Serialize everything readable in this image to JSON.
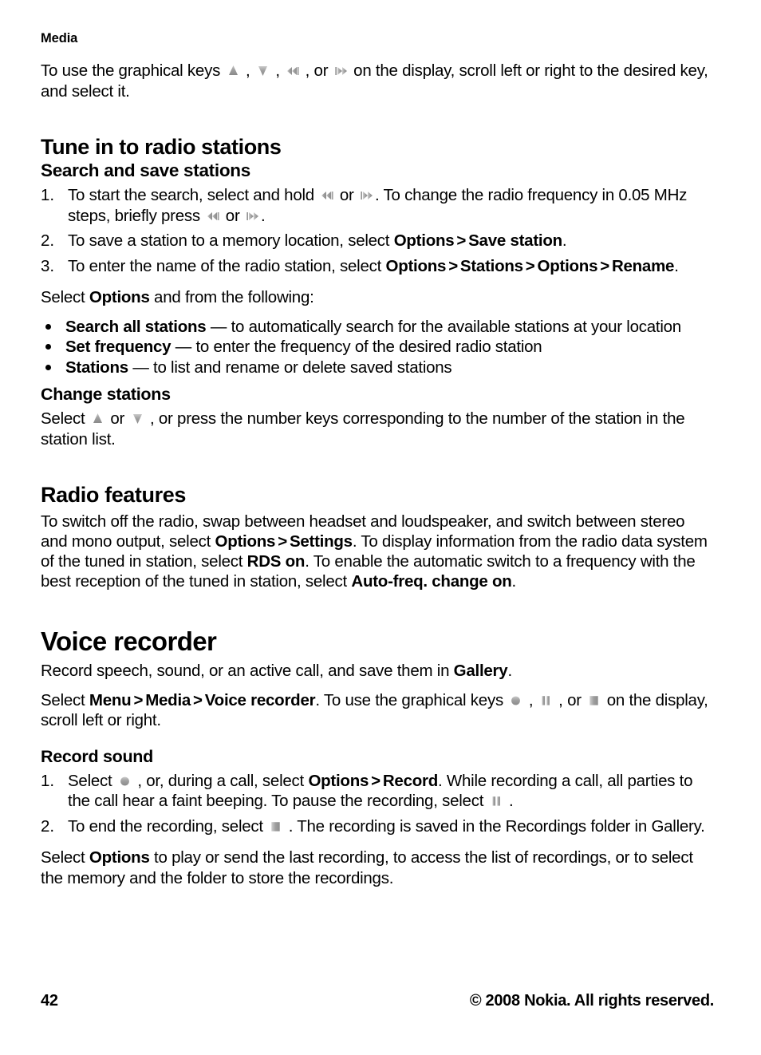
{
  "document": {
    "running_header": "Media",
    "page_number": "42",
    "copyright": "© 2008 Nokia. All rights reserved."
  },
  "intro": {
    "t1": "To use the graphical keys ",
    "t2": " , ",
    "t3": " , ",
    "t4": " , or ",
    "t5": " on the display, scroll left or right to the desired key, and select it."
  },
  "tune_in": {
    "heading": "Tune in to radio stations",
    "subheading": "Search and save stations",
    "steps": [
      {
        "num": "1.",
        "t1": "To start the search, select and hold ",
        "t2": " or ",
        "t3": ". To change the radio frequency in 0.05 MHz steps, briefly press ",
        "t4": " or ",
        "t5": "."
      },
      {
        "num": "2.",
        "t1": "To save a station to a memory location, select ",
        "b1": "Options",
        "gt": ">",
        "b2": "Save station",
        "t2": "."
      },
      {
        "num": "3.",
        "t1": "To enter the name of the radio station, select ",
        "b1": "Options",
        "gt1": ">",
        "b2": "Stations",
        "gt2": ">",
        "b3": "Options",
        "gt3": ">",
        "b4": "Rename",
        "t2": "."
      }
    ],
    "options_lead_1": "Select ",
    "options_lead_bold": "Options",
    "options_lead_2": " and from the following:",
    "bullets": [
      {
        "term": "Search all stations",
        "desc": " — to automatically search for the available stations at your location"
      },
      {
        "term": "Set frequency",
        "desc": " — to enter the frequency of the desired radio station"
      },
      {
        "term": "Stations",
        "desc": " — to list and rename or delete saved stations"
      }
    ],
    "change_stations": {
      "heading": "Change stations",
      "t1": "Select ",
      "t2": " or ",
      "t3": " , or press the number keys corresponding to the number of the station in the station list."
    }
  },
  "radio_features": {
    "heading": "Radio features",
    "t1": "To switch off the radio, swap between headset and loudspeaker, and switch between stereo and mono output, select ",
    "b1": "Options",
    "gt": ">",
    "b2": "Settings",
    "t2": ". To display information from the radio data system of the tuned in station, select ",
    "b3": "RDS on",
    "t3": ". To enable the automatic switch to a frequency with the best reception of the tuned in station, select ",
    "b4": "Auto-freq. change on",
    "t4": "."
  },
  "voice_recorder": {
    "heading": "Voice recorder",
    "intro": {
      "t1": "Record speech, sound, or an active call, and save them in ",
      "b1": "Gallery",
      "t2": "."
    },
    "path": {
      "t1": "Select ",
      "b1": "Menu",
      "gt1": ">",
      "b2": "Media",
      "gt2": ">",
      "b3": "Voice recorder",
      "t2": ". To use the graphical keys ",
      "t3": " , ",
      "t4": " , or ",
      "t5": " on the display, scroll left or right."
    },
    "record_sound": {
      "heading": "Record sound",
      "steps": [
        {
          "num": "1.",
          "t1": "Select ",
          "t2": " , or, during a call, select ",
          "b1": "Options",
          "gt": ">",
          "b2": "Record",
          "t3": ". While recording a call, all parties to the call hear a faint beeping. To pause the recording, select ",
          "t4": " ."
        },
        {
          "num": "2.",
          "t1": "To end the recording, select ",
          "t2": " . The recording is saved in the Recordings folder in Gallery."
        }
      ]
    },
    "options_note": {
      "t1": "Select ",
      "b1": "Options",
      "t2": " to play or send the last recording, to access the list of recordings, or to select the memory and the folder to store the recordings."
    }
  },
  "icons": {
    "up": "up-triangle-key-icon",
    "down": "down-triangle-key-icon",
    "rewind": "rewind-key-icon",
    "forward": "fast-forward-key-icon",
    "record": "record-key-icon",
    "pause": "pause-key-icon",
    "stop": "stop-key-icon"
  },
  "colors": {
    "text": "#000000",
    "background": "#ffffff",
    "icon_gray": "#9a9a9a"
  }
}
